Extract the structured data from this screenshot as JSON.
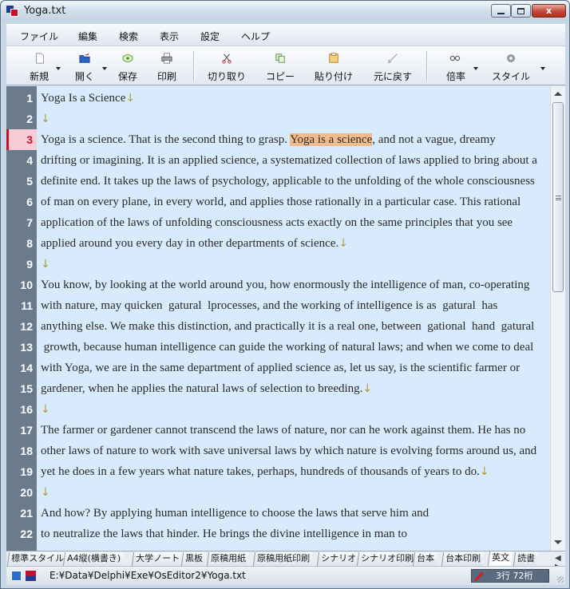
{
  "window": {
    "title": "Yoga.txt",
    "close_label": "x"
  },
  "menu": [
    "ファイル",
    "編集",
    "検索",
    "表示",
    "設定",
    "ヘルプ"
  ],
  "toolbar": [
    {
      "label": "新規",
      "icon": "new-document-icon",
      "dropdown": true
    },
    {
      "label": "開く",
      "icon": "open-folder-icon",
      "dropdown": true
    },
    {
      "label": "保存",
      "icon": "save-icon",
      "dropdown": false
    },
    {
      "label": "印刷",
      "icon": "printer-icon",
      "dropdown": false
    },
    {
      "label": "切り取り",
      "icon": "scissors-icon",
      "dropdown": false
    },
    {
      "label": "コピー",
      "icon": "copy-icon",
      "dropdown": false
    },
    {
      "label": "貼り付け",
      "icon": "paste-icon",
      "dropdown": false
    },
    {
      "label": "元に戻す",
      "icon": "undo-icon",
      "dropdown": false
    },
    {
      "label": "倍率",
      "icon": "glasses-icon",
      "dropdown": true
    },
    {
      "label": "スタイル",
      "icon": "gear-icon",
      "dropdown": true
    }
  ],
  "editor": {
    "current_line": 3,
    "selection_text": "Yoga is a science",
    "eol_mark": "↓",
    "lines": [
      {
        "n": "1",
        "pre": "Yoga Is a Science",
        "sel": "",
        "post": "",
        "eol": true
      },
      {
        "n": "2",
        "pre": "",
        "sel": "",
        "post": "",
        "eol": true
      },
      {
        "n": "3",
        "pre": "Yoga is a science. That is the second thing to grasp. ",
        "sel": "Yoga is a science",
        "post": ", and not a vague, dreamy",
        "eol": false
      },
      {
        "n": "4",
        "pre": "drifting or imagining. It is an applied science, a systematized collection of laws applied to bring about a",
        "sel": "",
        "post": "",
        "eol": false
      },
      {
        "n": "5",
        "pre": "definite end. It takes up the laws of psychology, applicable to the unfolding of the whole consciousness",
        "sel": "",
        "post": "",
        "eol": false
      },
      {
        "n": "6",
        "pre": "of man on every plane, in every world, and applies those rationally in a particular case. This rational",
        "sel": "",
        "post": "",
        "eol": false
      },
      {
        "n": "7",
        "pre": "application of the laws of unfolding consciousness acts exactly on the same principles that you see",
        "sel": "",
        "post": "",
        "eol": false
      },
      {
        "n": "8",
        "pre": "applied around you every day in other departments of science.",
        "sel": "",
        "post": "",
        "eol": true
      },
      {
        "n": "9",
        "pre": "",
        "sel": "",
        "post": "",
        "eol": true
      },
      {
        "n": "10",
        "pre": "You know, by looking at the world around you, how enormously the intelligence of man, co-operating",
        "sel": "",
        "post": "",
        "eol": false
      },
      {
        "n": "11",
        "pre": "with nature, may quicken  \u0000gatural  lprocesses, and the working of intelligence is as  \u0000gatural  has",
        "sel": "",
        "post": "",
        "eol": false
      },
      {
        "n": "12",
        "pre": "anything else. We make this distinction, and practically it is a real one, between  \u0000gational  hand  \u0000gatural",
        "sel": "",
        "post": "",
        "eol": false
      },
      {
        "n": "13",
        "pre": " growth, because human intelligence can guide the working of natural laws; and when we come to deal",
        "sel": "",
        "post": "",
        "eol": false
      },
      {
        "n": "14",
        "pre": "with Yoga, we are in the same department of applied science as, let us say, is the scientific farmer or",
        "sel": "",
        "post": "",
        "eol": false
      },
      {
        "n": "15",
        "pre": "gardener, when he applies the natural laws of selection to breeding.",
        "sel": "",
        "post": "",
        "eol": true
      },
      {
        "n": "16",
        "pre": "",
        "sel": "",
        "post": "",
        "eol": true
      },
      {
        "n": "17",
        "pre": "The farmer or gardener cannot transcend the laws of nature, nor can he work against them. He has no",
        "sel": "",
        "post": "",
        "eol": false
      },
      {
        "n": "18",
        "pre": "other laws of nature to work with save universal laws by which nature is evolving forms around us, and",
        "sel": "",
        "post": "",
        "eol": false
      },
      {
        "n": "19",
        "pre": "yet he does in a few years what nature takes, perhaps, hundreds of thousands of years to do.",
        "sel": "",
        "post": "",
        "eol": true
      },
      {
        "n": "20",
        "pre": "",
        "sel": "",
        "post": "",
        "eol": true
      },
      {
        "n": "21",
        "pre": "And how? By applying human intelligence to choose the laws that serve him and",
        "sel": "",
        "post": "",
        "eol": false
      },
      {
        "n": "22",
        "pre": "to neutralize the laws that hinder. He brings the divine intelligence in man to",
        "sel": "",
        "post": "",
        "eol": false
      }
    ]
  },
  "tabs": {
    "items": [
      "標準スタイル",
      "A4縦(横書き)",
      "大学ノート",
      "黒板",
      "原稿用紙",
      "原稿用紙印刷",
      "シナリオ",
      "シナリオ印刷",
      "台本",
      "台本印刷",
      "英文",
      "読書"
    ],
    "active": "英文",
    "nav_label": "◀ ▶"
  },
  "status": {
    "path": "E:¥Data¥Delphi¥Exe¥OsEditor2¥Yoga.txt",
    "position": "3行  72桁"
  },
  "colors": {
    "gutter": "#6c7b8c",
    "editor_bg": "#d7ebfc",
    "selection": "#f2bb8d",
    "current_line_marker": "#c8102e"
  }
}
